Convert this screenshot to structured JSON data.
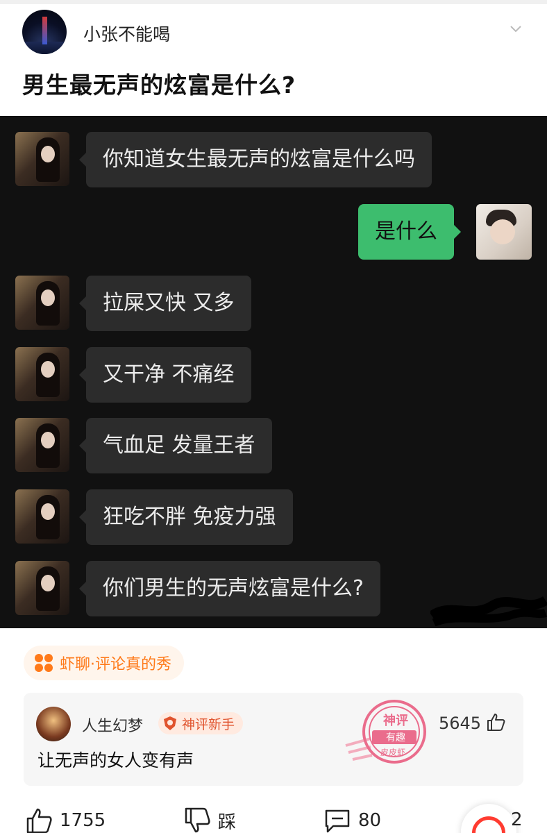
{
  "post": {
    "author_name": "小张不能喝",
    "title": "男生最无声的炫富是什么?"
  },
  "chat": {
    "messages": [
      {
        "side": "left",
        "text": "你知道女生最无声的炫富是什么吗"
      },
      {
        "side": "right",
        "text": "是什么"
      },
      {
        "side": "left",
        "text": "拉屎又快 又多"
      },
      {
        "side": "left",
        "text": "又干净 不痛经"
      },
      {
        "side": "left",
        "text": "气血足 发量王者"
      },
      {
        "side": "left",
        "text": "狂吃不胖 免疫力强"
      },
      {
        "side": "left",
        "text": "你们男生的无声炫富是什么?"
      }
    ]
  },
  "tag": {
    "label": "虾聊·评论真的秀",
    "color": "#ff7a1a"
  },
  "top_comment": {
    "username": "人生幻梦",
    "badge": "神评新手",
    "likes": "5645",
    "text": "让无声的女人变有声",
    "stamp": {
      "line1": "神评",
      "line2": "有趣",
      "line3": "皮皮虾"
    }
  },
  "actions": {
    "like_count": "1755",
    "dislike_label": "踩",
    "comment_count": "80",
    "share_count_partial": "2"
  },
  "colors": {
    "chat_bg": "#111111",
    "bubble_gray": "#2c2c2c",
    "bubble_green": "#3dbd6e",
    "accent_orange": "#ff7a1a",
    "stamp_pink": "#e8557a"
  }
}
